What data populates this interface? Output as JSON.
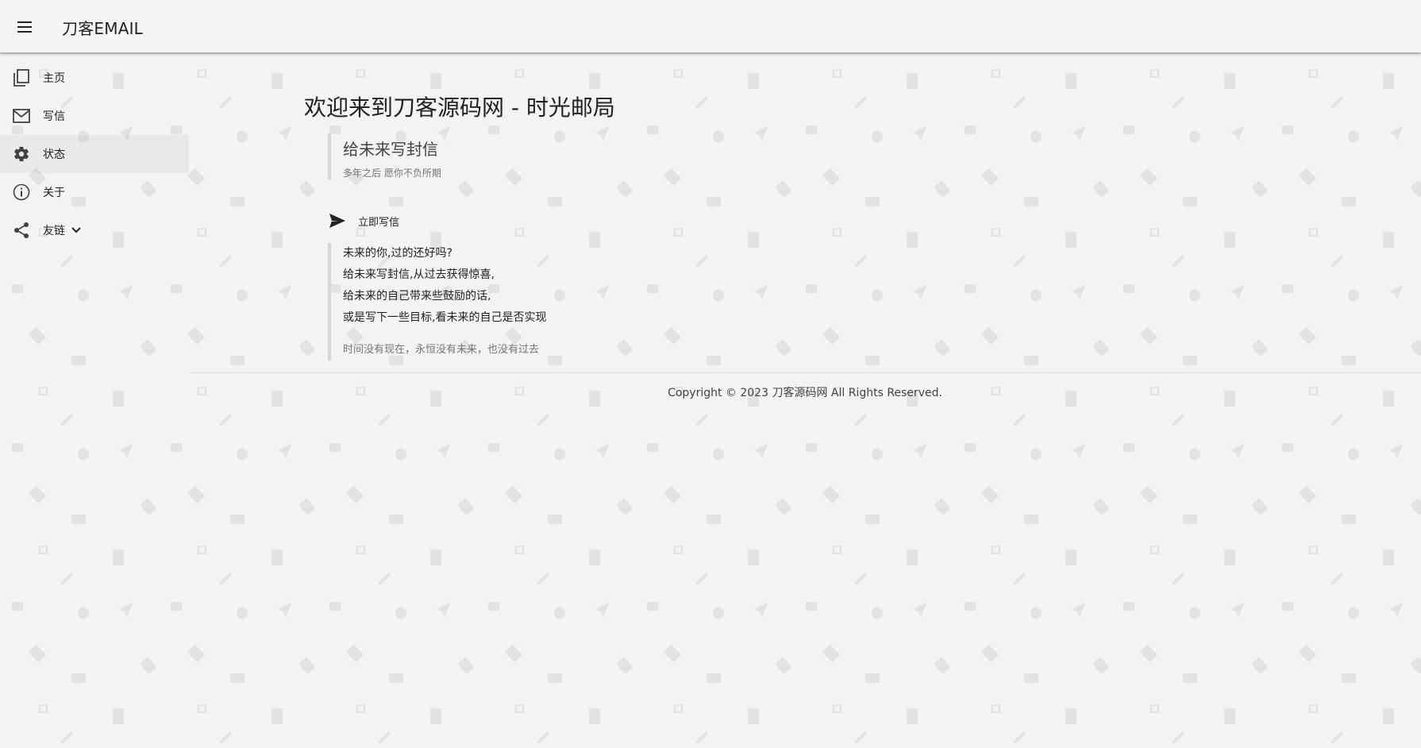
{
  "header": {
    "menu_icon": "hamburger-menu-icon",
    "title": "刀客EMAIL"
  },
  "sidebar": {
    "items": [
      {
        "label": "主页",
        "icon": "pages-icon",
        "active": false
      },
      {
        "label": "写信",
        "icon": "mail-icon",
        "active": false
      },
      {
        "label": "状态",
        "icon": "gear-icon",
        "active": true
      },
      {
        "label": "关于",
        "icon": "info-icon",
        "active": false
      },
      {
        "label": "友链",
        "icon": "share-icon",
        "active": false,
        "expand_icon": "chevron-down-icon"
      }
    ]
  },
  "main": {
    "title": "欢迎来到刀客源码网 - 时光邮局",
    "intro": {
      "heading": "给未来写封信",
      "subheading": "多年之后 愿你不负所期"
    },
    "write_button": {
      "icon": "send-icon",
      "label": "立即写信"
    },
    "poem": {
      "lines": [
        "未来的你,过的还好吗?",
        "给未来写封信,从过去获得惊喜,",
        "给未来的自己带来些鼓励的话,",
        "或是写下一些目标,看未来的自己是否实现"
      ],
      "footer": "时间没有现在，永恒没有未来，也没有过去"
    }
  },
  "footer": {
    "copyright": "Copyright © 2023 刀客源码网 All Rights Reserved."
  },
  "colors": {
    "background": "#f3f3f3",
    "pattern_icon": "#e3e3e3",
    "text": "#212121",
    "muted_text": "#757575",
    "quote_border": "#d6d6d6"
  }
}
